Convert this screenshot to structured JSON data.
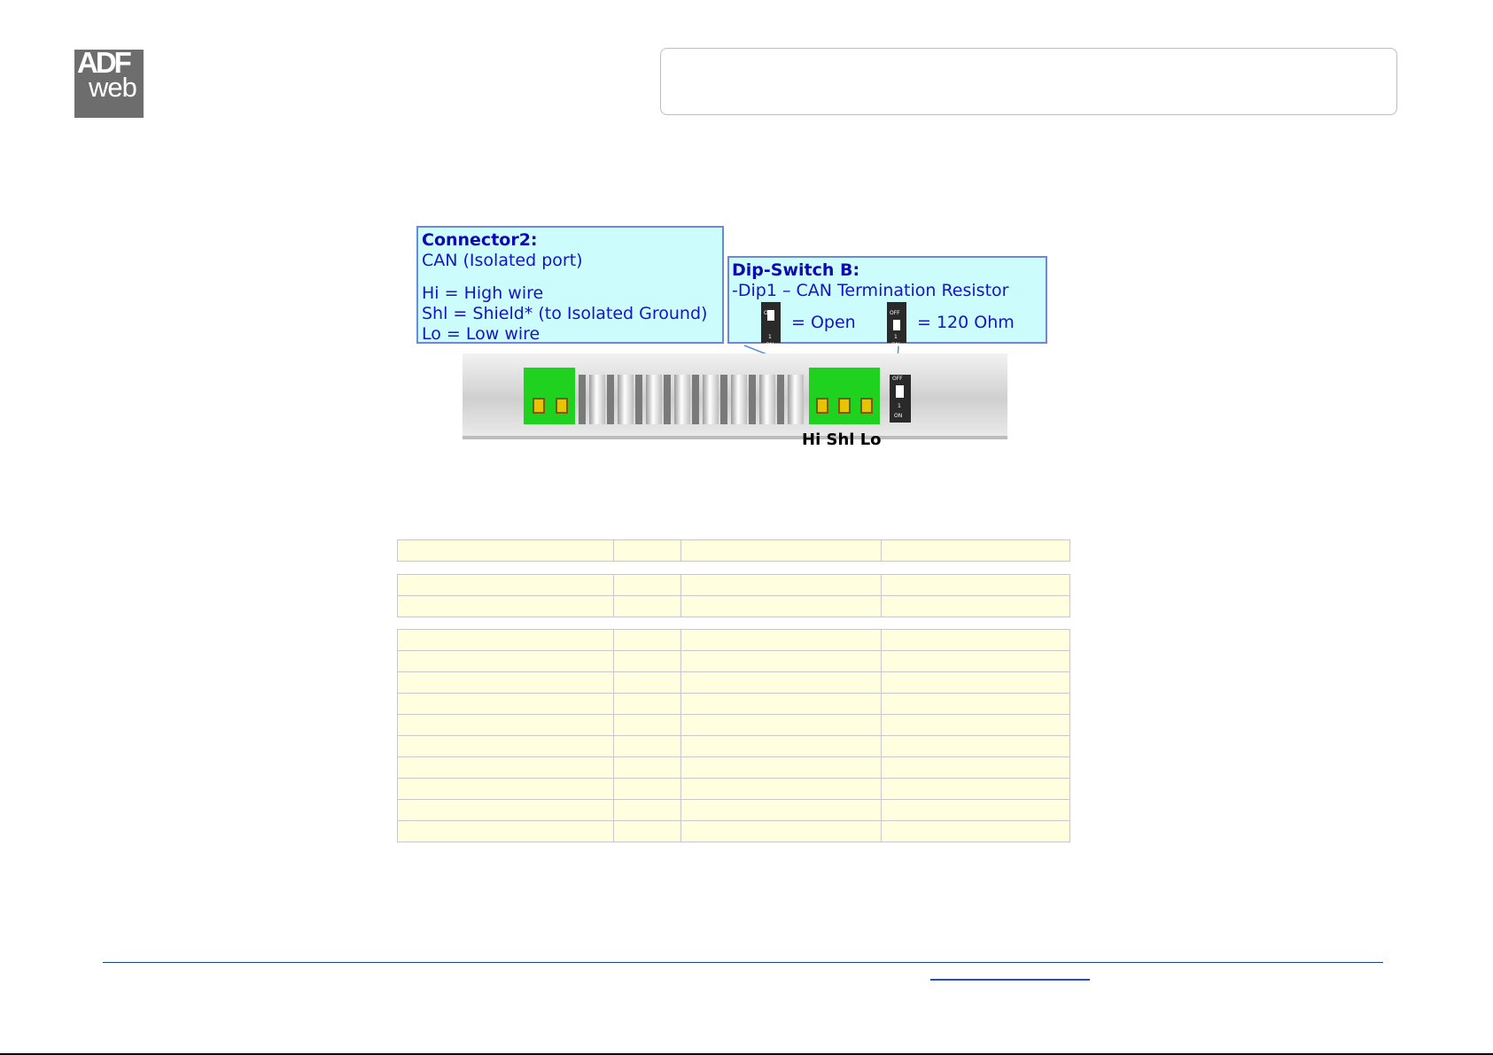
{
  "logo": {
    "line1": "ADF",
    "line2": "web"
  },
  "figure": {
    "connector_callout": {
      "title": "Connector2:",
      "subtitle": "CAN (Isolated port)",
      "lines": [
        "Hi = High wire",
        "Shl = Shield* (to Isolated Ground)",
        "Lo = Low wire"
      ]
    },
    "dip_callout": {
      "title": "Dip-Switch B:",
      "subtitle": "-Dip1 – CAN Termination Resistor",
      "open_label": "= Open",
      "ohm_label": "= 120 Ohm"
    },
    "dip_text": {
      "off": "OFF",
      "on": "ON",
      "one": "1"
    },
    "pin_labels": "Hi Shl Lo"
  },
  "table": {
    "groups": [
      1,
      2,
      10
    ],
    "columns": 4
  }
}
